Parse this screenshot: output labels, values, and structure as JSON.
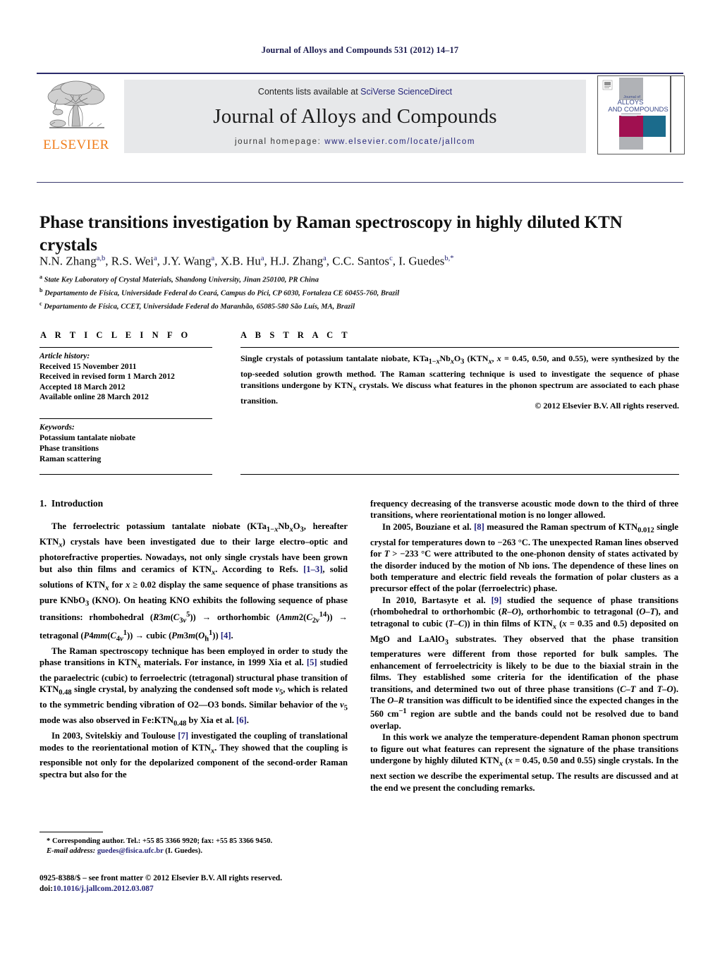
{
  "running_head": "Journal of Alloys and Compounds 531 (2012) 14–17",
  "masthead": {
    "publisher_name": "ELSEVIER",
    "contents_prefix": "Contents lists available at ",
    "contents_link": "SciVerse ScienceDirect",
    "journal_name": "Journal of Alloys and Compounds",
    "homepage_prefix": "journal homepage: ",
    "homepage_url": "www.elsevier.com/locate/jallcom",
    "cover": {
      "line1": "Journal of",
      "line2": "ALLOYS",
      "line3": "AND COMPOUNDS",
      "colors": {
        "grey": "#b0b2b6",
        "magenta": "#a01050",
        "teal": "#1b6b8c",
        "text": "#3a4a8a"
      }
    }
  },
  "article": {
    "title": "Phase transitions investigation by Raman spectroscopy in highly diluted KTN crystals",
    "authors_html": "N.N. Zhang<sup>a,b</sup>, R.S. Wei<sup>a</sup>, J.Y. Wang<sup>a</sup>, X.B. Hu<sup>a</sup>, H.J. Zhang<sup>a</sup>, C.C. Santos<sup>c</sup>, I. Guedes<sup>b,</sup><sup>*</sup>",
    "affiliations": [
      {
        "marker": "a",
        "text": "State Key Laboratory of Crystal Materials, Shandong University, Jinan 250100, PR China"
      },
      {
        "marker": "b",
        "text": "Departamento de Física, Universidade Federal do Ceará, Campus do Pici, CP 6030, Fortaleza CE 60455-760, Brazil"
      },
      {
        "marker": "c",
        "text": "Departamento de Física, CCET, Universidade Federal do Maranhão, 65085-580 São Luís, MA, Brazil"
      }
    ]
  },
  "article_info": {
    "heading": "A R T I C L E   I N F O",
    "history_label": "Article history:",
    "history": [
      "Received 15 November 2011",
      "Received in revised form 1 March 2012",
      "Accepted 18 March 2012",
      "Available online 28 March 2012"
    ],
    "keywords_label": "Keywords:",
    "keywords": [
      "Potassium tantalate niobate",
      "Phase transitions",
      "Raman scattering"
    ]
  },
  "abstract": {
    "heading": "A B S T R A C T",
    "text_html": "Single crystals of potassium tantalate niobate, KTa<sub>1−<i>x</i></sub>Nb<sub><i>x</i></sub>O<sub>3</sub> (KTN<sub><i>x</i></sub>, <i>x</i> = 0.45, 0.50, and 0.55), were synthesized by the top-seeded solution growth method. The Raman scattering technique is used to investigate the sequence of phase transitions undergone by KTN<sub><i>x</i></sub> crystals. We discuss what features in the phonon spectrum are associated to each phase transition.",
    "copyright": "© 2012 Elsevier B.V. All rights reserved."
  },
  "body": {
    "section_number": "1.",
    "section_title": "Introduction",
    "left_paragraphs_html": [
      "The ferroelectric potassium tantalate niobate (KTa<sub>1−<i>x</i></sub>Nb<sub><i>x</i></sub>O<sub>3</sub>, hereafter KTN<sub><i>x</i></sub>) crystals have been investigated due to their large electro–optic and photorefractive properties. Nowadays, not only single crystals have been grown but also thin films and ceramics of KTN<sub><i>x</i></sub>. According to Refs. <span class=\"ref\">[1–3]</span>, solid solutions of KTN<sub><i>x</i></sub> for <i>x</i> ≥ 0.02 display the same sequence of phase transitions as pure KNbO<sub>3</sub> (KNO). On heating KNO exhibits the following sequence of phase transitions: rhombohedral (<i>R</i>3<i>m</i>(<i>C</i><sub>3<i>v</i></sub><sup>5</sup>)) → orthorhombic (<i>Amm</i>2(<i>C</i><sub>2<i>v</i></sub><sup>14</sup>)) → tetragonal (<i>P</i>4<i>mm</i>(<i>C</i><sub>4<i>v</i></sub><sup>1</sup>)) → cubic (<i>Pm</i>3<i>m</i>(<i>O</i><sub>h</sub><sup>1</sup>)) <span class=\"ref\">[4]</span>.",
      "The Raman spectroscopy technique has been employed in order to study the phase transitions in KTN<sub><i>x</i></sub> materials. For instance, in 1999 Xia et al. <span class=\"ref\">[5]</span> studied the paraelectric (cubic) to ferroelectric (tetragonal) structural phase transition of KTN<sub>0.48</sub> single crystal, by analyzing the condensed soft mode <i>ν</i><sub>5</sub>, which is related to the symmetric bending vibration of O2—O3 bonds. Similar behavior of the <i>ν</i><sub>5</sub> mode was also observed in Fe:KTN<sub>0.48</sub> by Xia et al. <span class=\"ref\">[6]</span>.",
      "In 2003, Svitelskiy and Toulouse <span class=\"ref\">[7]</span> investigated the coupling of translational modes to the reorientational motion of KTN<sub><i>x</i></sub>. They showed that the coupling is responsible not only for the depolarized component of the second-order Raman spectra but also for the"
    ],
    "right_paragraphs_html": [
      "frequency decreasing of the transverse acoustic mode down to the third of three transitions, where reorientational motion is no longer allowed.",
      "In 2005, Bouziane et al. <span class=\"ref\">[8]</span> measured the Raman spectrum of KTN<sub>0.012</sub> single crystal for temperatures down to −263 °C. The unexpected Raman lines observed for <i>T</i> > −233 °C were attributed to the one-phonon density of states activated by the disorder induced by the motion of Nb ions. The dependence of these lines on both temperature and electric field reveals the formation of polar clusters as a precursor effect of the polar (ferroelectric) phase.",
      "In 2010, Bartasyte et al. <span class=\"ref\">[9]</span> studied the sequence of phase transitions (rhombohedral to orthorhombic (<i>R–O</i>), orthorhombic to tetragonal (<i>O–T</i>), and tetragonal to cubic (<i>T–C</i>)) in thin films of KTN<sub><i>x</i></sub> (<i>x</i> = 0.35 and 0.5) deposited on MgO and LaAlO<sub>3</sub> substrates. They observed that the phase transition temperatures were different from those reported for bulk samples. The enhancement of ferroelectricity is likely to be due to the biaxial strain in the films. They established some criteria for the identification of the phase transitions, and determined two out of three phase transitions (<i>C–T</i> and <i>T–O</i>). The <i>O–R</i> transition was difficult to be identified since the expected changes in the 560 cm<sup>−1</sup> region are subtle and the bands could not be resolved due to band overlap.",
      "In this work we analyze the temperature-dependent Raman phonon spectrum to figure out what features can represent the signature of the phase transitions undergone by highly diluted KTN<sub><i>x</i></sub> (<i>x</i> = 0.45, 0.50 and 0.55) single crystals. In the next section we describe the experimental setup. The results are discussed and at the end we present the concluding remarks."
    ]
  },
  "footer": {
    "corresponding_html": "* Corresponding author. Tel.: +55 85 3366 9920; fax: +55 85 3366 9450.",
    "email_label": "E-mail address:",
    "email": "guedes@fisica.ufc.br",
    "email_owner": "(I. Guedes).",
    "front_matter": "0925-8388/$ – see front matter © 2012 Elsevier B.V. All rights reserved.",
    "doi_label": "doi:",
    "doi": "10.1016/j.jallcom.2012.03.087"
  }
}
